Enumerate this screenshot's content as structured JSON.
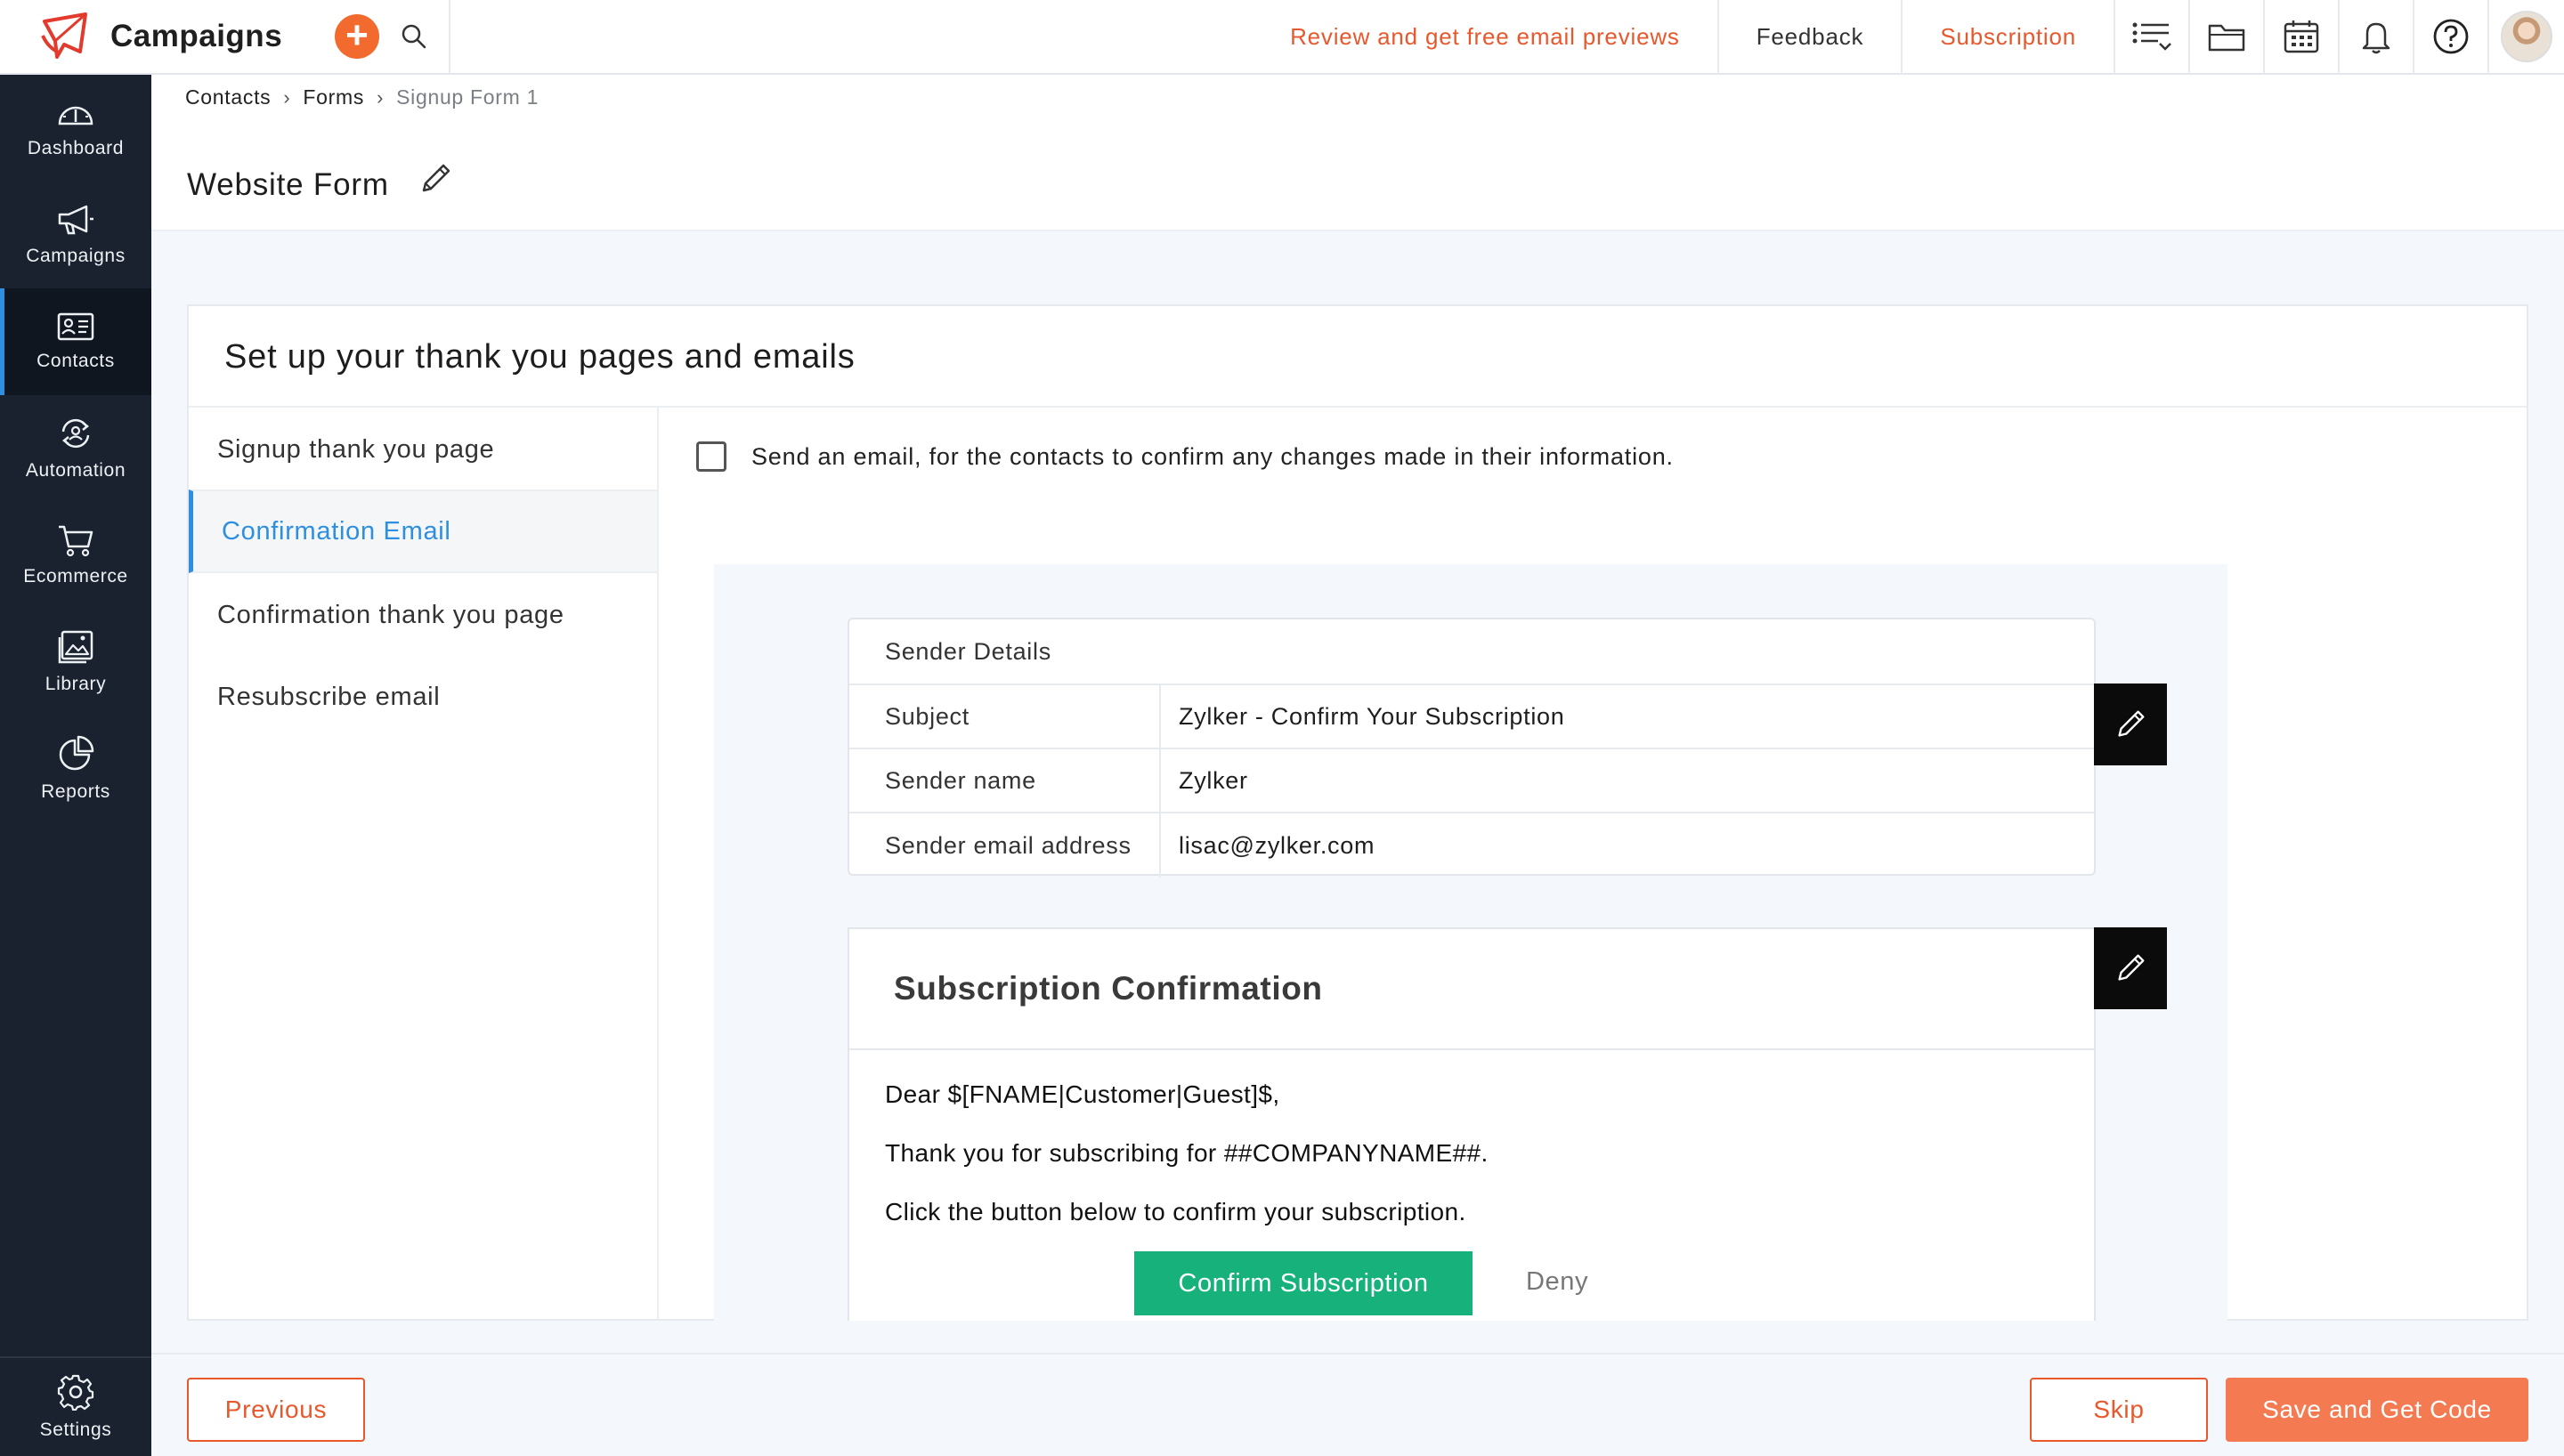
{
  "app": {
    "name": "Campaigns",
    "brand_color": "#e8582c",
    "add_icon": "plus-icon",
    "search_icon": "search-icon"
  },
  "topbar": {
    "review_link": "Review and get free email previews",
    "feedback": "Feedback",
    "subscription": "Subscription",
    "icons": [
      "list-icon",
      "folder-icon",
      "calendar-icon",
      "bell-icon",
      "help-icon",
      "avatar"
    ]
  },
  "sidebar": {
    "items": [
      {
        "label": "Dashboard",
        "icon": "dashboard-icon",
        "active": false
      },
      {
        "label": "Campaigns",
        "icon": "megaphone-icon",
        "active": false
      },
      {
        "label": "Contacts",
        "icon": "contact-card-icon",
        "active": true
      },
      {
        "label": "Automation",
        "icon": "automation-icon",
        "active": false
      },
      {
        "label": "Ecommerce",
        "icon": "cart-icon",
        "active": false
      },
      {
        "label": "Library",
        "icon": "image-icon",
        "active": false
      },
      {
        "label": "Reports",
        "icon": "pie-chart-icon",
        "active": false
      }
    ],
    "settings": {
      "label": "Settings",
      "icon": "gear-icon"
    }
  },
  "breadcrumb": [
    "Contacts",
    "Forms",
    "Signup Form 1"
  ],
  "page": {
    "title": "Website Form"
  },
  "card": {
    "title": "Set up your thank you pages and emails",
    "steps": [
      {
        "label": "Signup thank you page",
        "active": false
      },
      {
        "label": "Confirmation Email",
        "active": true
      },
      {
        "label": "Confirmation thank you page",
        "active": false
      },
      {
        "label": "Resubscribe email",
        "active": false
      }
    ],
    "checkbox": {
      "label": "Send an email, for the contacts to confirm any changes made in their information.",
      "checked": false
    }
  },
  "sender": {
    "heading": "Sender Details",
    "rows": [
      {
        "key": "Subject",
        "value": "Zylker - Confirm Your Subscription"
      },
      {
        "key": "Sender name",
        "value": "Zylker"
      },
      {
        "key": "Sender email address",
        "value": "lisac@zylker.com"
      }
    ]
  },
  "email": {
    "heading": "Subscription Confirmation",
    "greeting": "Dear $[FNAME|Customer|Guest]$,",
    "line1": "Thank you for subscribing for ##COMPANYNAME##.",
    "line2": "Click the button below to confirm your subscription.",
    "confirm_label": "Confirm Subscription",
    "deny_label": "Deny",
    "confirm_color": "#17b27c"
  },
  "footer": {
    "previous": "Previous",
    "skip": "Skip",
    "save": "Save and Get Code"
  }
}
